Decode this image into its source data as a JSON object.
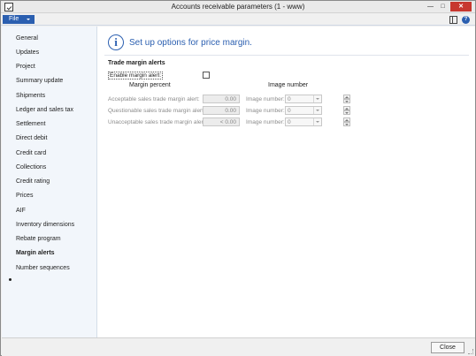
{
  "window": {
    "title": "Accounts receivable parameters (1 - www)"
  },
  "menubar": {
    "file_label": "File"
  },
  "sidebar": {
    "items": [
      {
        "label": "General"
      },
      {
        "label": "Updates"
      },
      {
        "label": "Project"
      },
      {
        "label": "Summary update"
      },
      {
        "label": "Shipments"
      },
      {
        "label": "Ledger and sales tax"
      },
      {
        "label": "Settlement"
      },
      {
        "label": "Direct debit"
      },
      {
        "label": "Credit card"
      },
      {
        "label": "Collections"
      },
      {
        "label": "Credit rating"
      },
      {
        "label": "Prices"
      },
      {
        "label": "AIF"
      },
      {
        "label": "Inventory dimensions"
      },
      {
        "label": "Rebate program"
      },
      {
        "label": "Margin alerts",
        "active": true
      },
      {
        "label": "Number sequences"
      }
    ]
  },
  "main": {
    "heading": "Set up options for price margin.",
    "group_title": "Trade margin alerts",
    "enable_label": "Enable margin alert:",
    "enable_checked": false,
    "col_margin": "Margin percent",
    "col_image": "Image number",
    "rows": [
      {
        "label": "Acceptable sales trade margin alert:",
        "value": "0.00",
        "image_label": "Image number:",
        "image_value": "0"
      },
      {
        "label": "Questionable sales trade margin alert:",
        "value": "0.00",
        "image_label": "Image number:",
        "image_value": "0"
      },
      {
        "label": "Unacceptable sales trade margin alert:",
        "value": "< 0.00",
        "image_label": "Image number:",
        "image_value": "0"
      }
    ]
  },
  "footer": {
    "close_label": "Close"
  },
  "colors": {
    "accent": "#2b5fb0",
    "close_red": "#c7372f"
  }
}
